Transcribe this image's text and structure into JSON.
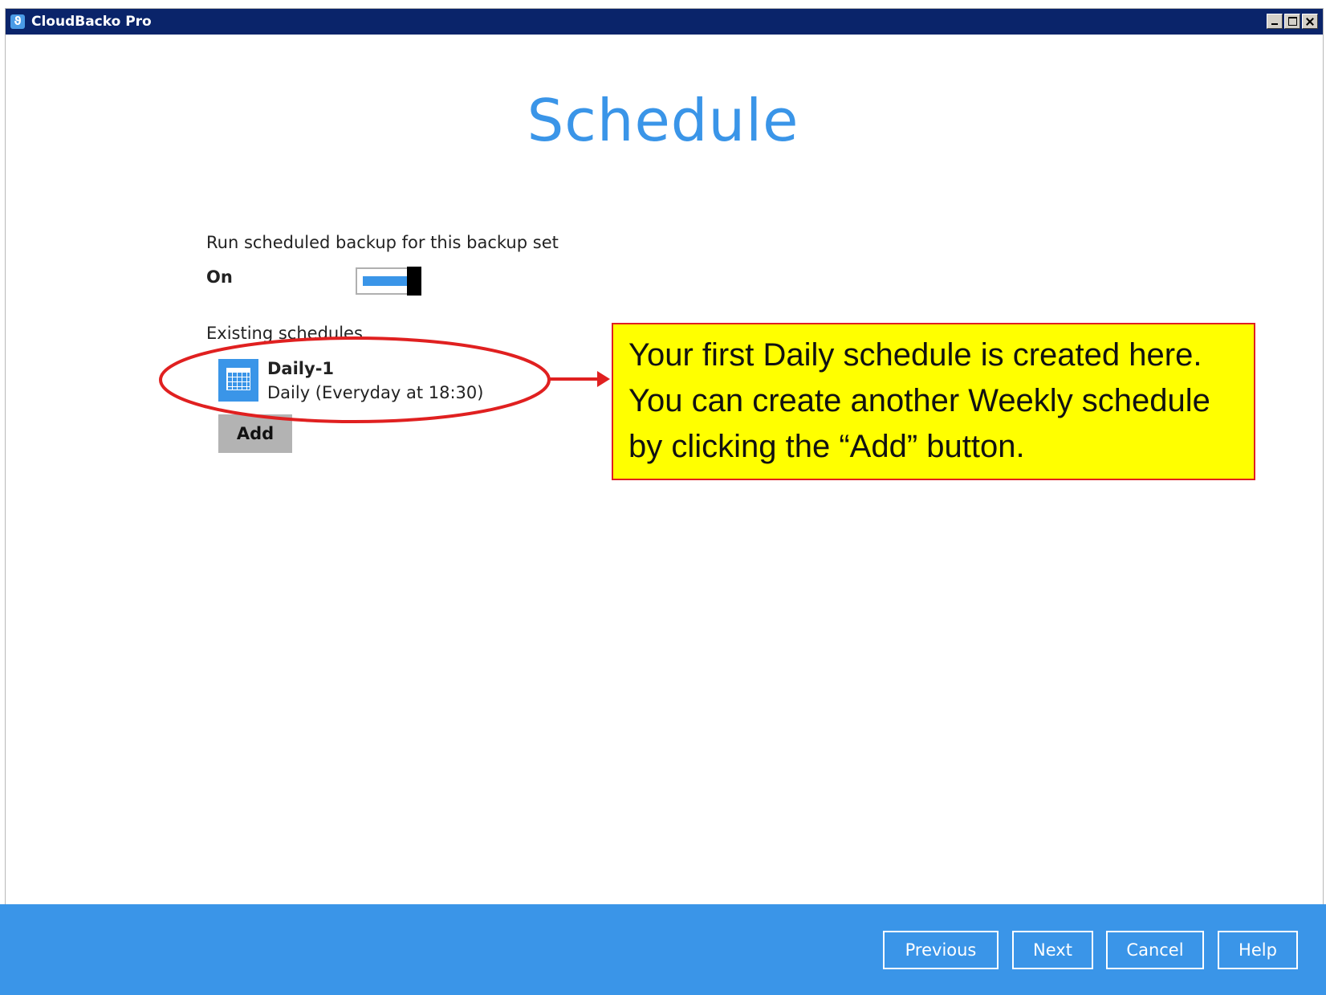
{
  "window": {
    "title": "CloudBacko Pro",
    "app_icon": "cloudbacko-logo-icon"
  },
  "page": {
    "title": "Schedule"
  },
  "schedule_settings": {
    "run_label": "Run scheduled backup for this backup set",
    "toggle_state_label": "On",
    "toggle_on": true,
    "existing_label": "Existing schedules",
    "schedules": [
      {
        "name": "Daily-1",
        "description": "Daily (Everyday at 18:30)",
        "icon": "calendar-icon"
      }
    ],
    "add_label": "Add"
  },
  "annotation": {
    "callout_text": "Your first Daily schedule is created here. You can create another Weekly schedule by clicking the “Add” button.",
    "callout_bg": "#ffff00",
    "highlight_color": "#e02020"
  },
  "footer": {
    "previous_label": "Previous",
    "next_label": "Next",
    "cancel_label": "Cancel",
    "help_label": "Help"
  },
  "colors": {
    "accent": "#3a95e8",
    "titlebar": "#0a246a"
  }
}
